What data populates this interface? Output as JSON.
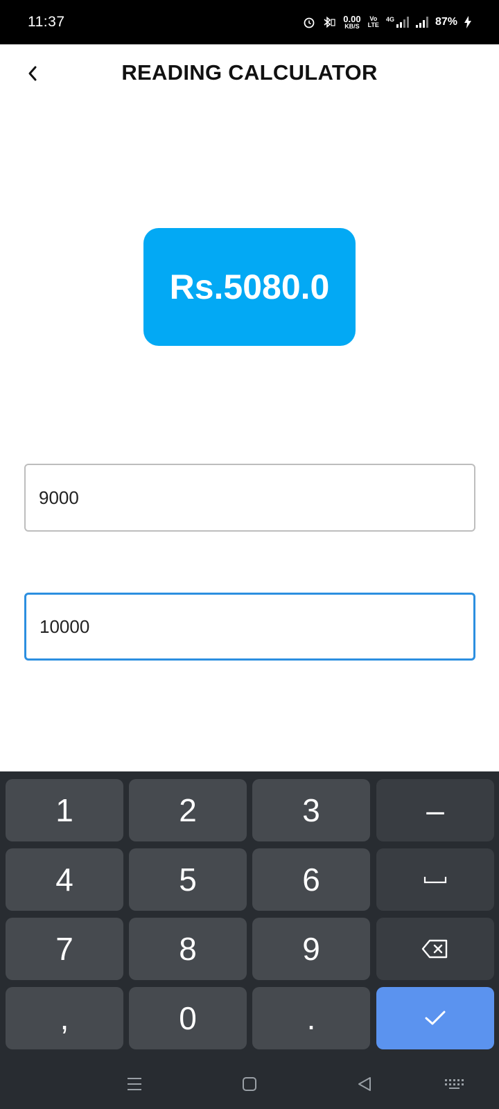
{
  "status_bar": {
    "time": "11:37",
    "net_speed_value": "0.00",
    "net_speed_unit": "KB/S",
    "volte_top": "Vo",
    "volte_bottom": "LTE",
    "network_type": "4G",
    "battery": "87%"
  },
  "header": {
    "title": "READING CALCULATOR"
  },
  "result": {
    "amount": "Rs.5080.0"
  },
  "inputs": {
    "previous_reading": "9000",
    "current_reading": "10000"
  },
  "keyboard": {
    "keys": [
      "1",
      "2",
      "3",
      "–",
      "4",
      "5",
      "6",
      "7",
      "8",
      "9",
      ",",
      "0",
      "."
    ]
  },
  "colors": {
    "accent": "#03a9f4",
    "focus_border": "#2c8fe0",
    "enter_key": "#5b93ef",
    "keyboard_bg": "#282c31"
  }
}
